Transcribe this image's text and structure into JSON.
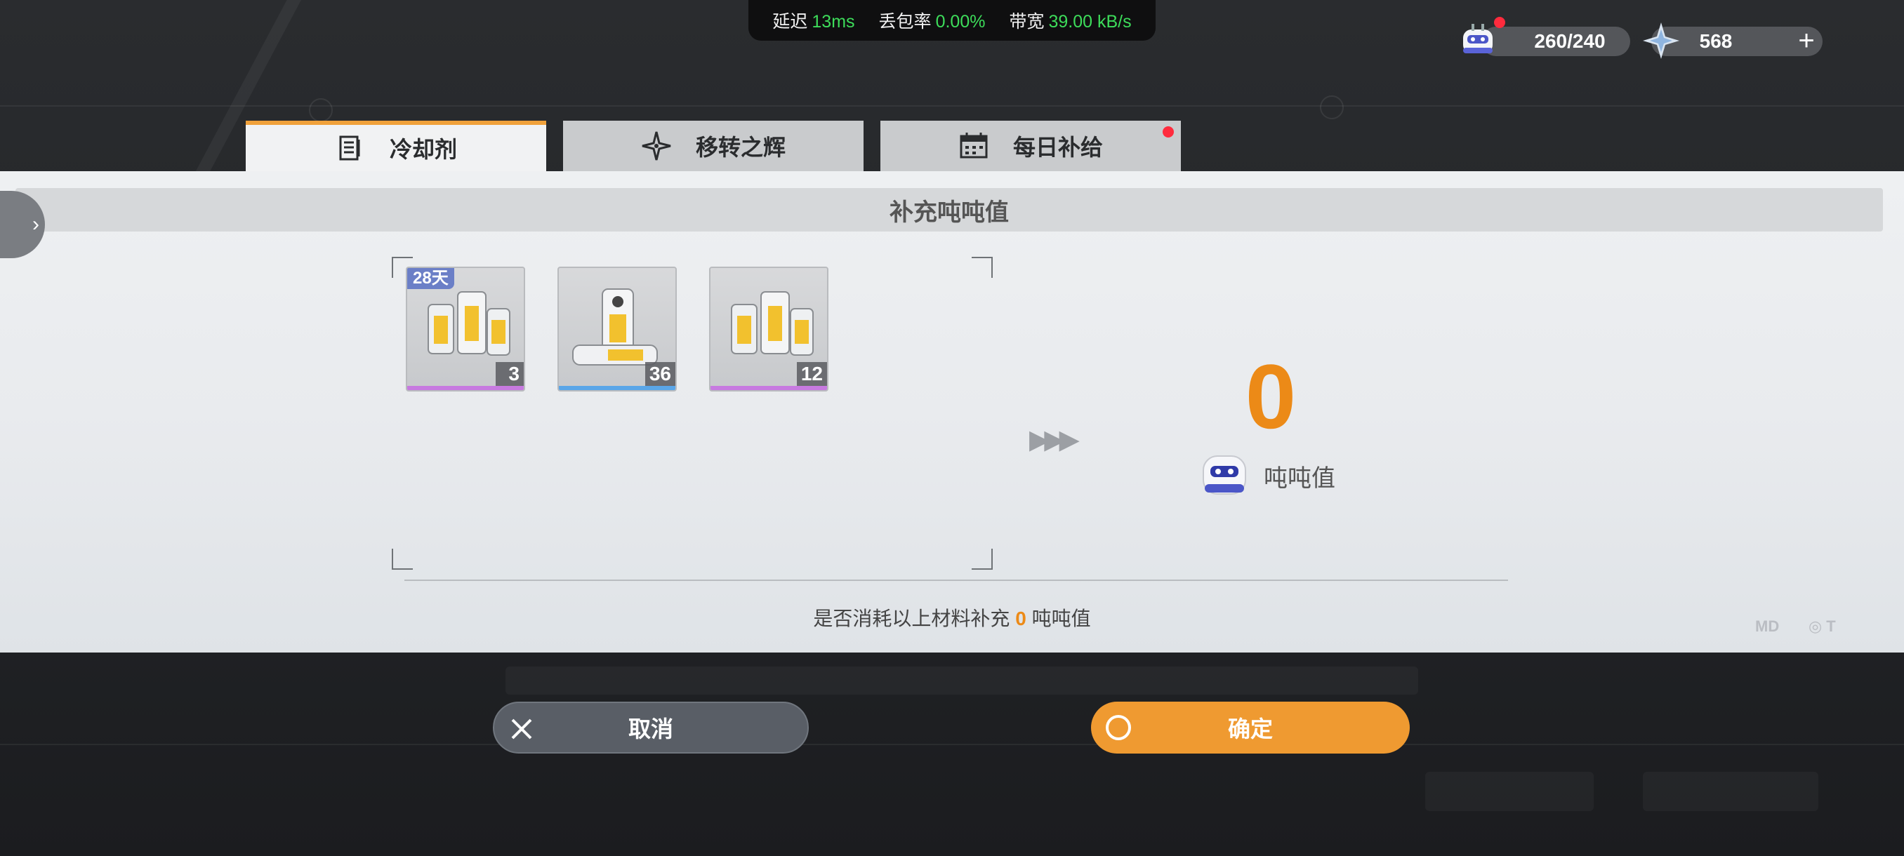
{
  "network": {
    "latency_label": "延迟",
    "latency_value": "13ms",
    "loss_label": "丢包率",
    "loss_value": "0.00%",
    "bandwidth_label": "带宽",
    "bandwidth_value": "39.00 kB/s"
  },
  "resources": {
    "energy": "260/240",
    "crystal": "568",
    "plus": "+"
  },
  "tabs": [
    {
      "label": "冷却剂",
      "icon": "list-icon",
      "active": true
    },
    {
      "label": "移转之辉",
      "icon": "star-icon",
      "active": false
    },
    {
      "label": "每日补给",
      "icon": "calendar-icon",
      "active": false,
      "badge": true
    }
  ],
  "panel": {
    "title": "补充吨吨值",
    "items": [
      {
        "count": "3",
        "days": "28天",
        "rarity": "purple",
        "rarity_color": "#c77ae0"
      },
      {
        "count": "36",
        "rarity": "blue",
        "rarity_color": "#5aa6e8"
      },
      {
        "count": "12",
        "rarity": "purple",
        "rarity_color": "#c77ae0"
      }
    ],
    "arrows": "▶▶▶",
    "result_value": "0",
    "result_label": "吨吨值",
    "confirm_prefix": "是否消耗以上材料补充",
    "confirm_value": "0",
    "confirm_suffix": "吨吨值"
  },
  "buttons": {
    "cancel": "取消",
    "ok": "确定"
  },
  "colors": {
    "accent": "#ef9a31",
    "highlight": "#ec8a17",
    "net_value": "#3ddc5a"
  }
}
